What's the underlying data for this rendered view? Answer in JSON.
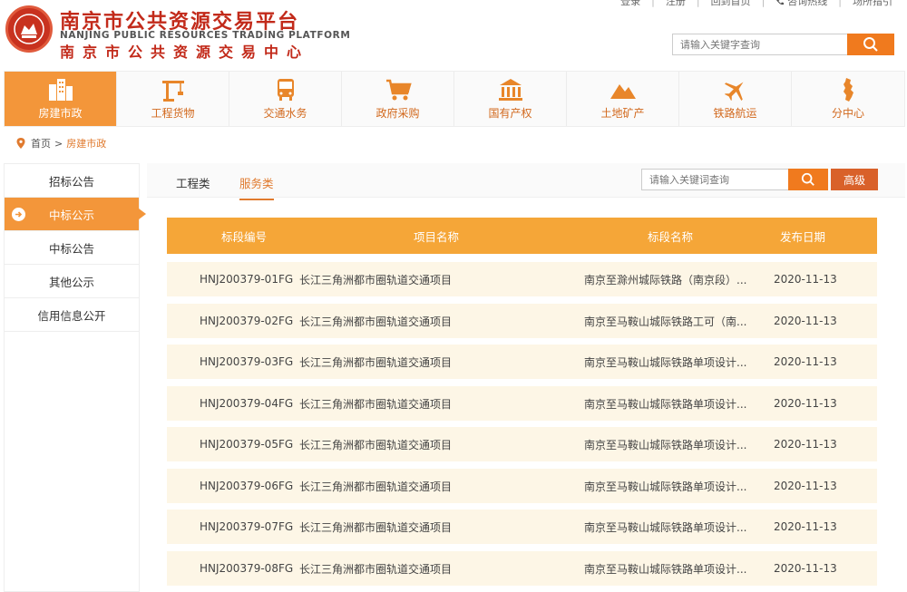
{
  "header": {
    "brand_cn": "南京市公共资源交易平台",
    "brand_en": "NANJING PUBLIC RESOURCES TRADING PLATFORM",
    "brand_sub": "南京市公共资源交易中心",
    "links": [
      "登录",
      "注册",
      "回到首页",
      "咨询热线",
      "场所指引"
    ],
    "search_placeholder": "请输入关键字查询"
  },
  "nav": [
    {
      "label": "房建市政",
      "icon": "buildings-icon",
      "active": true
    },
    {
      "label": "工程货物",
      "icon": "crane-icon",
      "active": false
    },
    {
      "label": "交通水务",
      "icon": "bus-icon",
      "active": false
    },
    {
      "label": "政府采购",
      "icon": "shopping-cart-icon",
      "active": false
    },
    {
      "label": "国有产权",
      "icon": "bank-icon",
      "active": false
    },
    {
      "label": "土地矿产",
      "icon": "mountain-icon",
      "active": false
    },
    {
      "label": "铁路航运",
      "icon": "airplane-icon",
      "active": false
    },
    {
      "label": "分中心",
      "icon": "map-region-icon",
      "active": false
    }
  ],
  "breadcrumb": {
    "home": "首页",
    "arrow": ">",
    "current": "房建市政"
  },
  "sidebar": [
    {
      "label": "招标公告",
      "active": false
    },
    {
      "label": "中标公示",
      "active": true
    },
    {
      "label": "中标公告",
      "active": false
    },
    {
      "label": "其他公示",
      "active": false
    },
    {
      "label": "信用信息公开",
      "active": false
    }
  ],
  "main": {
    "tabs": [
      {
        "label": "工程类",
        "active": false
      },
      {
        "label": "服务类",
        "active": true
      }
    ],
    "search_placeholder": "请输入关键词查询",
    "advanced_label": "高级",
    "columns": [
      "标段编号",
      "项目名称",
      "标段名称",
      "发布日期"
    ],
    "rows": [
      {
        "code": "HNJ200379-01FG",
        "project": "长江三角洲都市圈轨道交通项目",
        "section": "南京至滁州城际铁路（南京段）...",
        "date": "2020-11-13"
      },
      {
        "code": "HNJ200379-02FG",
        "project": "长江三角洲都市圈轨道交通项目",
        "section": "南京至马鞍山城际铁路工可（南...",
        "date": "2020-11-13"
      },
      {
        "code": "HNJ200379-03FG",
        "project": "长江三角洲都市圈轨道交通项目",
        "section": "南京至马鞍山城际铁路单项设计...",
        "date": "2020-11-13"
      },
      {
        "code": "HNJ200379-04FG",
        "project": "长江三角洲都市圈轨道交通项目",
        "section": "南京至马鞍山城际铁路单项设计...",
        "date": "2020-11-13"
      },
      {
        "code": "HNJ200379-05FG",
        "project": "长江三角洲都市圈轨道交通项目",
        "section": "南京至马鞍山城际铁路单项设计...",
        "date": "2020-11-13"
      },
      {
        "code": "HNJ200379-06FG",
        "project": "长江三角洲都市圈轨道交通项目",
        "section": "南京至马鞍山城际铁路单项设计...",
        "date": "2020-11-13"
      },
      {
        "code": "HNJ200379-07FG",
        "project": "长江三角洲都市圈轨道交通项目",
        "section": "南京至马鞍山城际铁路单项设计...",
        "date": "2020-11-13"
      },
      {
        "code": "HNJ200379-08FG",
        "project": "长江三角洲都市圈轨道交通项目",
        "section": "南京至马鞍山城际铁路单项设计...",
        "date": "2020-11-13"
      }
    ]
  },
  "colors": {
    "accent": "#f3963a",
    "header_row": "#f5a638",
    "row_bg": "#fdf6e6",
    "brand_red": "#c22a1a"
  }
}
